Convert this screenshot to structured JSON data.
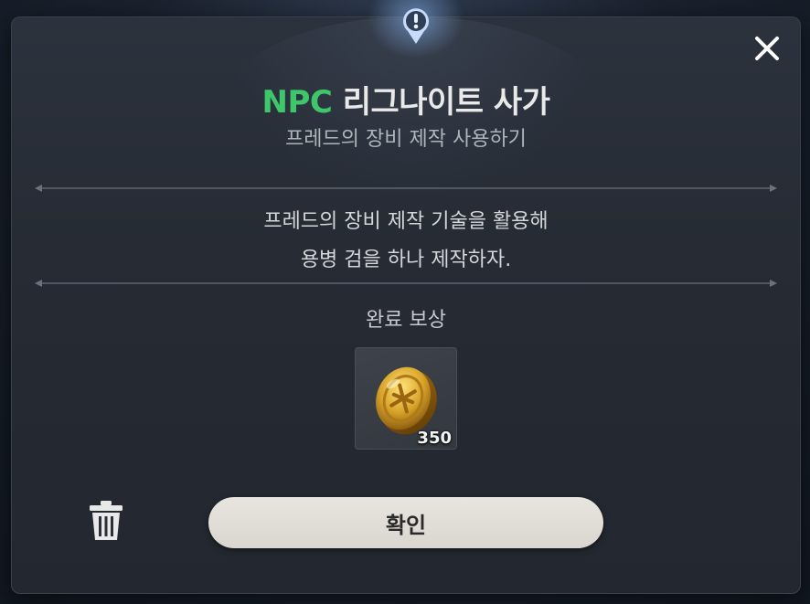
{
  "dialog": {
    "title_prefix": "NPC",
    "title_name": "리그나이트 사가",
    "subtitle": "프레드의 장비 제작 사용하기",
    "description_line1": "프레드의 장비 제작 기술을 활용해",
    "description_line2": "용병 검을 하나 제작하자.",
    "reward_label": "완료 보상",
    "reward": {
      "icon": "gold-coin-icon",
      "quantity": "350"
    },
    "confirm_label": "확인"
  },
  "icons": {
    "alert": "alert-marker-icon",
    "close": "close-icon",
    "trash": "trash-icon"
  },
  "colors": {
    "npc_accent": "#3ec76a",
    "dialog_bg": "#282d36",
    "button_bg": "#e3e0da"
  }
}
